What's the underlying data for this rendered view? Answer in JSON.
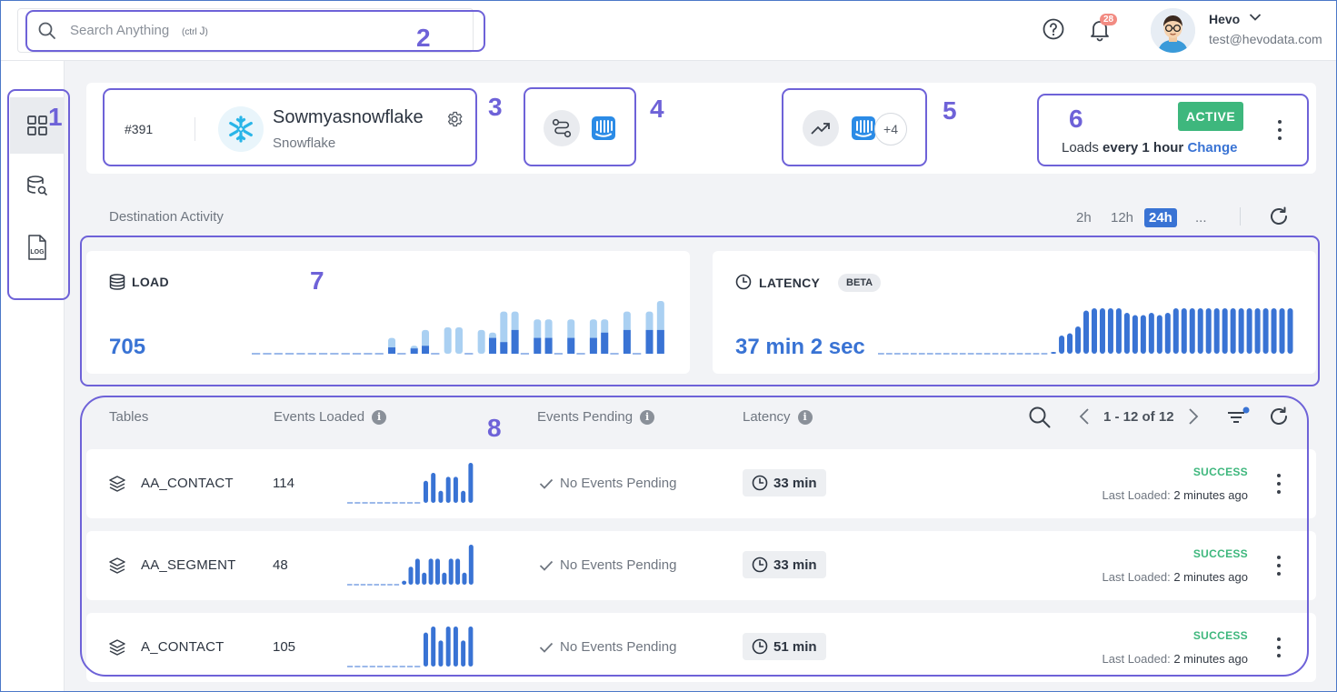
{
  "search": {
    "placeholder": "Search Anything",
    "shortcut_prefix": "ctrl",
    "shortcut_key": "J"
  },
  "topbar": {
    "notifications_count": "28",
    "user_name": "Hevo",
    "user_email": "test@hevodata.com"
  },
  "sidebar": {
    "items": [
      {
        "icon": "dashboard-grid-icon",
        "active": true
      },
      {
        "icon": "database-search-icon",
        "active": false
      },
      {
        "icon": "log-file-icon",
        "active": false
      }
    ]
  },
  "annotations": [
    "1",
    "2",
    "3",
    "4",
    "5",
    "6",
    "7",
    "8"
  ],
  "destination": {
    "id": "#391",
    "name": "Sowmyasnowflake",
    "type": "Snowflake",
    "logo": "snowflake-icon"
  },
  "pipelines": {
    "icon": "pipeline-route-icon",
    "source_icon": "intercom-icon"
  },
  "models": {
    "icon": "trend-up-icon",
    "source_icon": "intercom-icon",
    "more_label": "+4"
  },
  "status": {
    "badge": "ACTIVE",
    "loads_prefix": "Loads",
    "loads_frequency": "every 1 hour",
    "change_label": "Change"
  },
  "activity": {
    "title": "Destination Activity",
    "ranges": [
      "2h",
      "12h",
      "24h",
      "..."
    ],
    "active_range": "24h"
  },
  "load_card": {
    "label": "LOAD",
    "value": "705",
    "bars_total": [
      0,
      0,
      0,
      0,
      0,
      0,
      0,
      0,
      0,
      0,
      0,
      0,
      0.3,
      0,
      0.15,
      0.45,
      0,
      0.5,
      0.5,
      0,
      0.45,
      0.4,
      0.8,
      0.8,
      0,
      0.65,
      0.65,
      0,
      0.65,
      0,
      0.65,
      0.65,
      0,
      0.8,
      0,
      0.8,
      1
    ],
    "bars_success": [
      0,
      0,
      0,
      0,
      0,
      0,
      0,
      0,
      0,
      0,
      0,
      0,
      0.12,
      0,
      0.1,
      0.15,
      0,
      0,
      0,
      0,
      0,
      0.3,
      0.22,
      0.45,
      0,
      0.3,
      0.3,
      0,
      0.3,
      0,
      0.3,
      0.4,
      0,
      0.45,
      0,
      0.45,
      0.45
    ]
  },
  "latency_card": {
    "label": "LATENCY",
    "beta_label": "BETA",
    "value": "37 min 2 sec",
    "bars": [
      0,
      0,
      0,
      0,
      0,
      0,
      0,
      0,
      0,
      0,
      0,
      0,
      0,
      0,
      0,
      0,
      0,
      0,
      0,
      0,
      0,
      0.04,
      0.4,
      0.45,
      0.6,
      0.95,
      1,
      1,
      1,
      1,
      0.9,
      0.85,
      0.85,
      0.9,
      0.85,
      0.9,
      1,
      1,
      1,
      1,
      1,
      1,
      1,
      1,
      1,
      1,
      1,
      1,
      1,
      1,
      1
    ]
  },
  "table": {
    "columns": [
      "Tables",
      "Events Loaded",
      "Events Pending",
      "Latency"
    ],
    "pagination": "1 - 12 of 12",
    "rows": [
      {
        "name": "AA_CONTACT",
        "events": "114",
        "pending": "No Events Pending",
        "latency": "33 min",
        "status": "SUCCESS",
        "last_label": "Last Loaded:",
        "last_value": "2 minutes ago",
        "spark": [
          0,
          0,
          0,
          0,
          0,
          0,
          0,
          0,
          0,
          0,
          0.55,
          0.75,
          0.3,
          0.65,
          0.65,
          0.3,
          1
        ]
      },
      {
        "name": "AA_SEGMENT",
        "events": "48",
        "pending": "No Events Pending",
        "latency": "33 min",
        "status": "SUCCESS",
        "last_label": "Last Loaded:",
        "last_value": "2 minutes ago",
        "spark": [
          0,
          0,
          0,
          0,
          0,
          0,
          0,
          0,
          0.1,
          0.45,
          0.65,
          0.3,
          0.65,
          0.65,
          0.3,
          0.65,
          0.65,
          0.3,
          1
        ]
      },
      {
        "name": "A_CONTACT",
        "events": "105",
        "pending": "No Events Pending",
        "latency": "51 min",
        "status": "SUCCESS",
        "last_label": "Last Loaded:",
        "last_value": "2 minutes ago",
        "spark": [
          0,
          0,
          0,
          0,
          0,
          0,
          0,
          0,
          0,
          0,
          0.85,
          1,
          0.65,
          1,
          1,
          0.65,
          1
        ]
      }
    ]
  },
  "colors": {
    "accent": "#3973d4",
    "bar_light": "#aad0f2",
    "success": "#3eb77d",
    "annotation": "#6e62d8",
    "badge": "#f28b82"
  }
}
